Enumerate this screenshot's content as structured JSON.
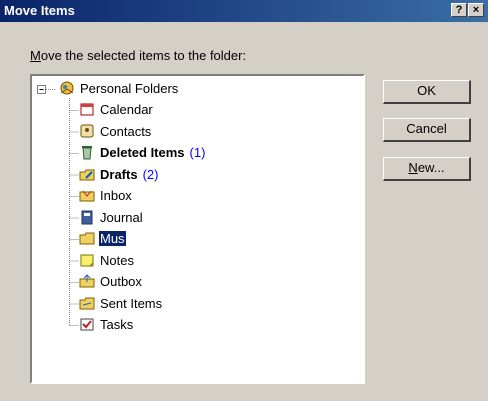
{
  "dialog": {
    "title": "Move Items",
    "help_glyph": "?",
    "close_glyph": "×"
  },
  "prompt": {
    "mnemonic": "M",
    "rest": "ove the selected items to the folder:"
  },
  "tree": {
    "root": {
      "label": "Personal Folders",
      "expanded": true,
      "expander": "−",
      "icon": "personal-folders-icon"
    },
    "children": [
      {
        "label": "Calendar",
        "icon": "calendar-icon"
      },
      {
        "label": "Contacts",
        "icon": "contacts-icon"
      },
      {
        "label": "Deleted Items",
        "bold": true,
        "count": "(1)",
        "icon": "trash-icon"
      },
      {
        "label": "Drafts",
        "bold": true,
        "count": "(2)",
        "icon": "drafts-icon"
      },
      {
        "label": "Inbox",
        "icon": "inbox-icon"
      },
      {
        "label": "Journal",
        "icon": "journal-icon"
      },
      {
        "label": "Mus",
        "selected": true,
        "icon": "folder-icon"
      },
      {
        "label": "Notes",
        "icon": "notes-icon"
      },
      {
        "label": "Outbox",
        "icon": "outbox-icon"
      },
      {
        "label": "Sent Items",
        "icon": "sent-items-icon"
      },
      {
        "label": "Tasks",
        "icon": "tasks-icon"
      }
    ]
  },
  "buttons": {
    "ok": "OK",
    "cancel": "Cancel",
    "new_mnemonic": "N",
    "new_rest": "ew..."
  },
  "colors": {
    "titlebar": "#0a246a",
    "selection": "#0a246a",
    "count": "#0000ff",
    "face": "#d4d0c8"
  }
}
